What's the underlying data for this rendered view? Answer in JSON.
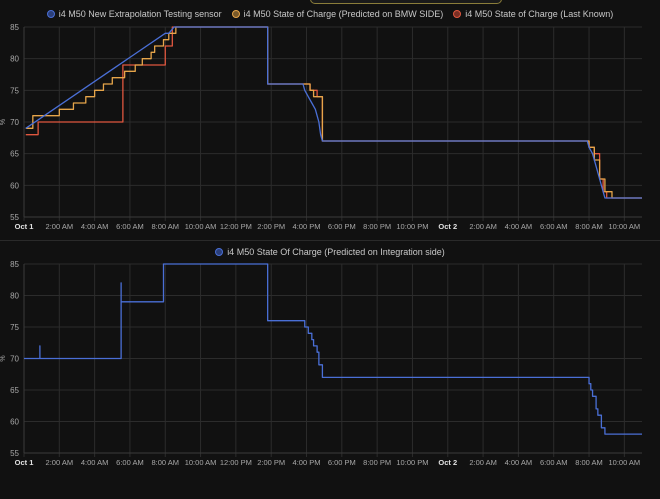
{
  "chart_data": [
    {
      "type": "line",
      "legend_placement": "top",
      "ylabel": "%",
      "ylim": [
        55,
        85
      ],
      "y_ticks": [
        "55",
        "60",
        "65",
        "70",
        "75",
        "80",
        "85"
      ],
      "x_range_hours": [
        0,
        35
      ],
      "x_ticks": [
        {
          "h": 0,
          "label": "Oct 1",
          "bold": true
        },
        {
          "h": 2,
          "label": "2:00 AM"
        },
        {
          "h": 4,
          "label": "4:00 AM"
        },
        {
          "h": 6,
          "label": "6:00 AM"
        },
        {
          "h": 8,
          "label": "8:00 AM"
        },
        {
          "h": 10,
          "label": "10:00 AM"
        },
        {
          "h": 12,
          "label": "12:00 PM"
        },
        {
          "h": 14,
          "label": "2:00 PM"
        },
        {
          "h": 16,
          "label": "4:00 PM"
        },
        {
          "h": 18,
          "label": "6:00 PM"
        },
        {
          "h": 20,
          "label": "8:00 PM"
        },
        {
          "h": 22,
          "label": "10:00 PM"
        },
        {
          "h": 24,
          "label": "Oct 2",
          "bold": true
        },
        {
          "h": 26,
          "label": "2:00 AM"
        },
        {
          "h": 28,
          "label": "4:00 AM"
        },
        {
          "h": 30,
          "label": "6:00 AM"
        },
        {
          "h": 32,
          "label": "8:00 AM"
        },
        {
          "h": 34,
          "label": "10:00 AM"
        }
      ],
      "grid": true,
      "series": [
        {
          "name": "i4 M50 New Extrapolation Testing sensor",
          "color": "#4a6fd6",
          "step": false,
          "points": [
            [
              0.1,
              69
            ],
            [
              8,
              84
            ],
            [
              8.2,
              84
            ],
            [
              8.5,
              85
            ],
            [
              13.8,
              85
            ],
            [
              13.8,
              76
            ],
            [
              15.8,
              76
            ],
            [
              15.9,
              75
            ],
            [
              16.1,
              74
            ],
            [
              16.3,
              73
            ],
            [
              16.5,
              72
            ],
            [
              16.6,
              71
            ],
            [
              16.7,
              70
            ],
            [
              16.8,
              68
            ],
            [
              16.9,
              67
            ],
            [
              31.9,
              67
            ],
            [
              32,
              66
            ],
            [
              32.2,
              65
            ],
            [
              32.4,
              63
            ],
            [
              32.6,
              61
            ],
            [
              32.8,
              59
            ],
            [
              32.9,
              58
            ],
            [
              35,
              58
            ]
          ]
        },
        {
          "name": "i4 M50 State of Charge (Predicted on BMW SIDE)",
          "color": "#e6a54a",
          "step": true,
          "points": [
            [
              0.1,
              69
            ],
            [
              0.5,
              71
            ],
            [
              1.6,
              71
            ],
            [
              2,
              72
            ],
            [
              2.8,
              73
            ],
            [
              3.5,
              74
            ],
            [
              4,
              75
            ],
            [
              4.5,
              76
            ],
            [
              5,
              77
            ],
            [
              5.7,
              78
            ],
            [
              6.3,
              79
            ],
            [
              6.7,
              80
            ],
            [
              7.2,
              81
            ],
            [
              7.4,
              82
            ],
            [
              7.9,
              83
            ],
            [
              8.2,
              84
            ],
            [
              8.6,
              85
            ],
            [
              13.8,
              85
            ],
            [
              13.8,
              76
            ],
            [
              15.8,
              76
            ],
            [
              16.2,
              75
            ],
            [
              16.4,
              74
            ],
            [
              16.9,
              67
            ],
            [
              31.9,
              67
            ],
            [
              32,
              66
            ],
            [
              32.3,
              64
            ],
            [
              32.6,
              61
            ],
            [
              32.9,
              59
            ],
            [
              33.3,
              58
            ],
            [
              35,
              58
            ]
          ]
        },
        {
          "name": "i4 M50 State of Charge (Last Known)",
          "color": "#e0573f",
          "step": true,
          "points": [
            [
              0.1,
              68
            ],
            [
              0.8,
              70
            ],
            [
              5.6,
              70
            ],
            [
              5.6,
              79
            ],
            [
              7.9,
              79
            ],
            [
              8,
              82
            ],
            [
              8.4,
              85
            ],
            [
              13.8,
              85
            ],
            [
              13.8,
              76
            ],
            [
              16,
              76
            ],
            [
              16.2,
              75
            ],
            [
              16.6,
              74
            ],
            [
              16.9,
              67
            ],
            [
              31.9,
              67
            ],
            [
              32,
              66
            ],
            [
              32.3,
              65
            ],
            [
              32.6,
              61
            ],
            [
              32.8,
              59
            ],
            [
              33,
              58
            ],
            [
              35,
              58
            ]
          ]
        }
      ]
    },
    {
      "type": "line",
      "legend_placement": "top",
      "ylabel": "%",
      "ylim": [
        55,
        85
      ],
      "y_ticks": [
        "55",
        "60",
        "65",
        "70",
        "75",
        "80",
        "85"
      ],
      "x_range_hours": [
        0,
        35
      ],
      "x_ticks": [
        {
          "h": 0,
          "label": "Oct 1",
          "bold": true
        },
        {
          "h": 2,
          "label": "2:00 AM"
        },
        {
          "h": 4,
          "label": "4:00 AM"
        },
        {
          "h": 6,
          "label": "6:00 AM"
        },
        {
          "h": 8,
          "label": "8:00 AM"
        },
        {
          "h": 10,
          "label": "10:00 AM"
        },
        {
          "h": 12,
          "label": "12:00 PM"
        },
        {
          "h": 14,
          "label": "2:00 PM"
        },
        {
          "h": 16,
          "label": "4:00 PM"
        },
        {
          "h": 18,
          "label": "6:00 PM"
        },
        {
          "h": 20,
          "label": "8:00 PM"
        },
        {
          "h": 22,
          "label": "10:00 PM"
        },
        {
          "h": 24,
          "label": "Oct 2",
          "bold": true
        },
        {
          "h": 26,
          "label": "2:00 AM"
        },
        {
          "h": 28,
          "label": "4:00 AM"
        },
        {
          "h": 30,
          "label": "6:00 AM"
        },
        {
          "h": 32,
          "label": "8:00 AM"
        },
        {
          "h": 34,
          "label": "10:00 AM"
        }
      ],
      "grid": true,
      "series": [
        {
          "name": "i4 M50 State Of Charge (Predicted on Integration side)",
          "color": "#4a6fd6",
          "step": true,
          "points": [
            [
              0,
              70
            ],
            [
              0.9,
              72
            ],
            [
              0.9,
              70
            ],
            [
              1.1,
              70
            ],
            [
              5.5,
              82
            ],
            [
              5.5,
              79
            ],
            [
              5.7,
              79
            ],
            [
              7.9,
              85
            ],
            [
              13.8,
              85
            ],
            [
              13.8,
              76
            ],
            [
              15.8,
              76
            ],
            [
              15.9,
              75
            ],
            [
              16.1,
              74
            ],
            [
              16.3,
              73
            ],
            [
              16.4,
              72
            ],
            [
              16.6,
              71
            ],
            [
              16.7,
              69
            ],
            [
              16.9,
              67
            ],
            [
              31.9,
              67
            ],
            [
              32,
              66
            ],
            [
              32.1,
              65
            ],
            [
              32.2,
              64
            ],
            [
              32.4,
              62
            ],
            [
              32.5,
              61
            ],
            [
              32.7,
              59
            ],
            [
              32.9,
              58
            ],
            [
              35,
              58
            ]
          ]
        }
      ]
    }
  ]
}
